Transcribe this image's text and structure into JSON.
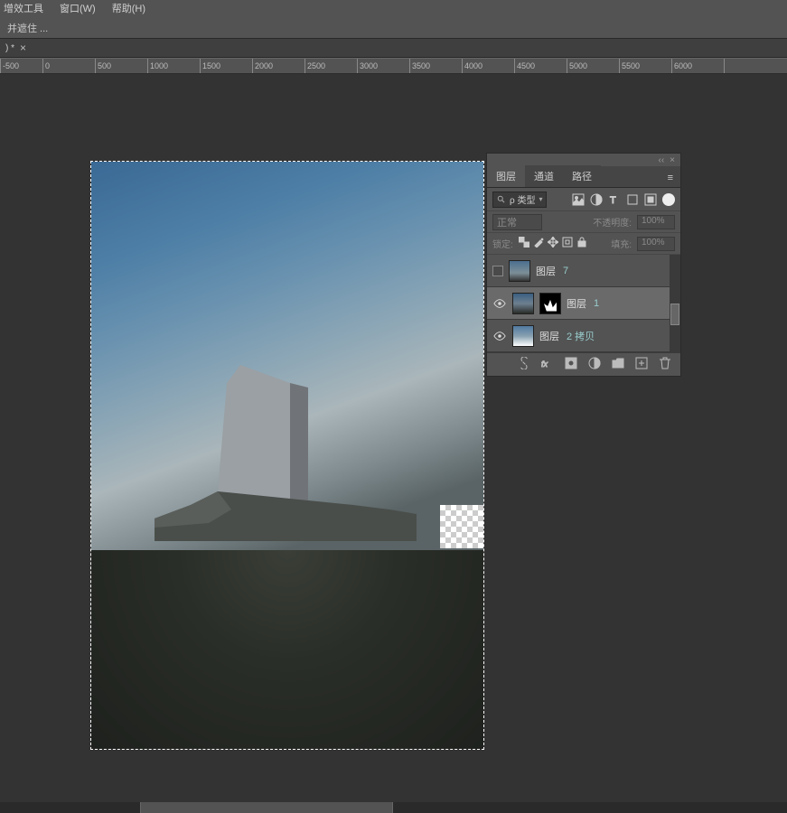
{
  "menu": {
    "plugins": "增效工具",
    "window": "窗口(W)",
    "help": "帮助(H)"
  },
  "optbar": {
    "text": "并遮住 ..."
  },
  "tab": {
    "label": ") *",
    "close": "×"
  },
  "ruler": {
    "ticks": [
      "-500",
      "0",
      "500",
      "1000",
      "1500",
      "2000",
      "2500",
      "3000",
      "3500",
      "4000",
      "4500",
      "5000",
      "5500",
      "6000"
    ]
  },
  "panel": {
    "collapse": "‹‹",
    "close": "×",
    "tabs": {
      "layers": "图层",
      "channels": "通道",
      "paths": "路径"
    },
    "menu_icon": "≡",
    "filter": {
      "kind": "ρ 类型"
    },
    "blend": {
      "mode": "正常",
      "opacity_label": "不透明度:",
      "opacity_value": "100%"
    },
    "lock": {
      "label": "锁定:",
      "fill_label": "填充:",
      "fill_value": "100%"
    },
    "layers": [
      {
        "name": "图层",
        "num": "7",
        "visible": false
      },
      {
        "name": "图层",
        "num": "1",
        "visible": true,
        "has_mask": true,
        "active": true
      },
      {
        "name": "图层",
        "num": "2 拷贝",
        "visible": true
      }
    ]
  }
}
